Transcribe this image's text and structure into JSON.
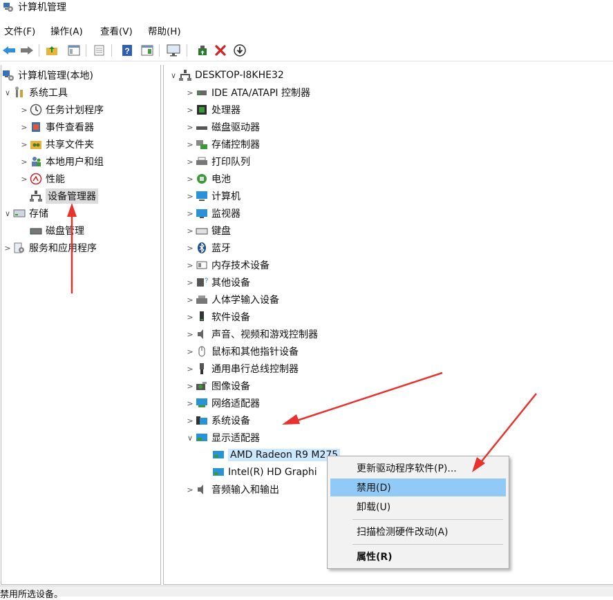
{
  "window": {
    "title": "计算机管理"
  },
  "menubar": [
    "文件(F)",
    "操作(A)",
    "查看(V)",
    "帮助(H)"
  ],
  "toolbar": {
    "icons": [
      "back-arrow-icon",
      "forward-arrow-icon",
      "up-folder-icon",
      "show-hide-tree-icon",
      "properties-icon",
      "help-icon",
      "action-pane-icon",
      "monitor-icon",
      "update-driver-icon",
      "uninstall-icon",
      "disable-icon"
    ]
  },
  "left_tree": {
    "root": "计算机管理(本地)",
    "system_tools": "系统工具",
    "task_scheduler": "任务计划程序",
    "event_viewer": "事件查看器",
    "shared_folders": "共享文件夹",
    "local_users": "本地用户和组",
    "performance": "性能",
    "device_manager": "设备管理器",
    "storage": "存储",
    "disk_management": "磁盘管理",
    "services": "服务和应用程序"
  },
  "device_tree": {
    "computer": "DESKTOP-I8KHE32",
    "categories": [
      "IDE ATA/ATAPI 控制器",
      "处理器",
      "磁盘驱动器",
      "存储控制器",
      "打印队列",
      "电池",
      "计算机",
      "监视器",
      "键盘",
      "蓝牙",
      "内存技术设备",
      "其他设备",
      "人体学输入设备",
      "软件设备",
      "声音、视频和游戏控制器",
      "鼠标和其他指针设备",
      "通用串行总线控制器",
      "图像设备",
      "网络适配器",
      "系统设备",
      "显示适配器"
    ],
    "display_children": [
      "AMD Radeon R9 M275",
      "Intel(R) HD Graphi"
    ],
    "audio": "音频输入和输出"
  },
  "context_menu": {
    "update": "更新驱动程序软件(P)...",
    "disable": "禁用(D)",
    "uninstall": "卸载(U)",
    "scan": "扫描检测硬件改动(A)",
    "properties": "属性(R)"
  },
  "status": {
    "text": "禁用所选设备。"
  },
  "colors": {
    "annotation_arrow": "#e8322e",
    "menu_highlight": "#91c9f7"
  }
}
